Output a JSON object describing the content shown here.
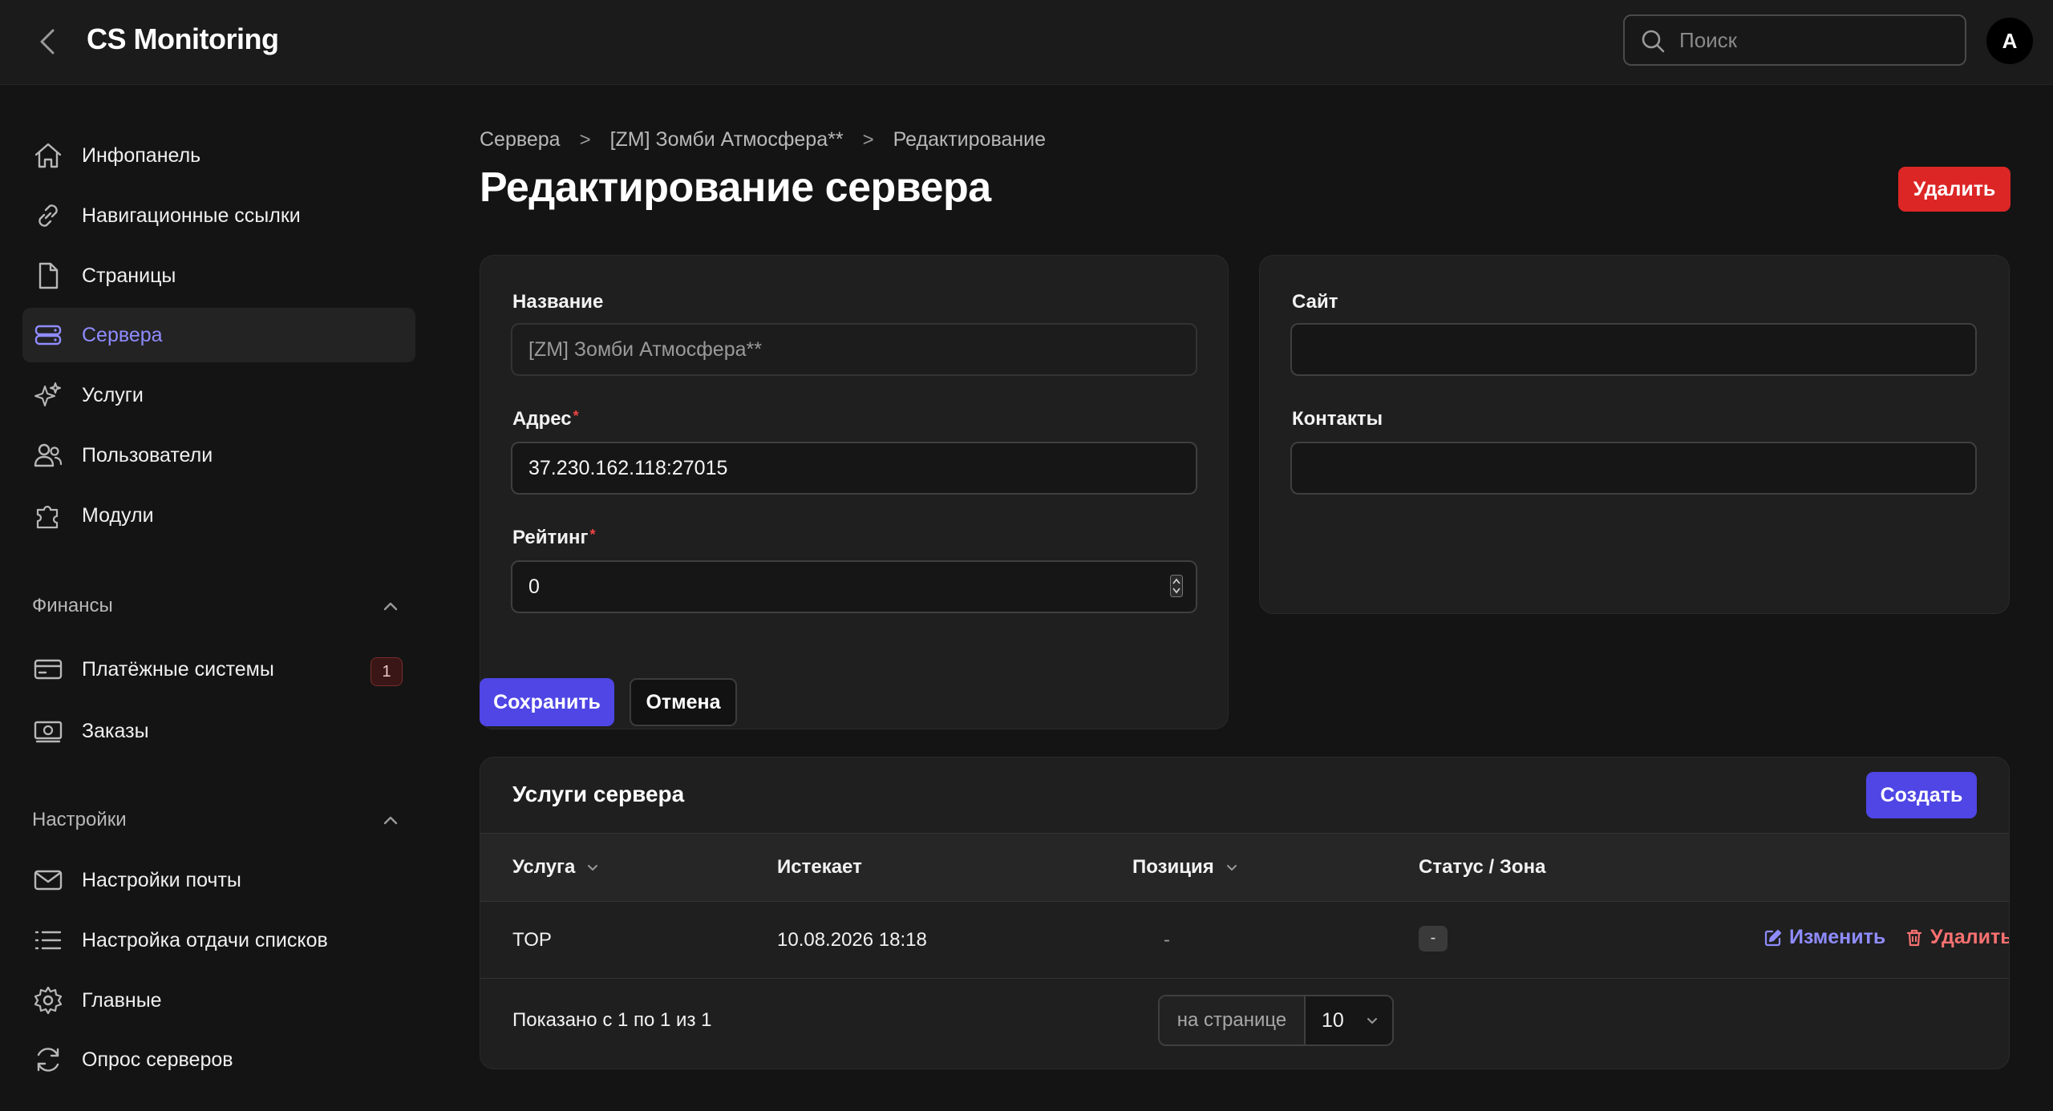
{
  "app": {
    "title": "CS Monitoring"
  },
  "search": {
    "placeholder": "Поиск"
  },
  "user": {
    "avatar_letter": "A"
  },
  "sidebar": {
    "items": [
      {
        "label": "Инфопанель",
        "icon": "home-icon"
      },
      {
        "label": "Навигационные ссылки",
        "icon": "link-icon"
      },
      {
        "label": "Страницы",
        "icon": "document-icon"
      },
      {
        "label": "Сервера",
        "icon": "server-icon",
        "active": true
      },
      {
        "label": "Услуги",
        "icon": "sparkles-icon"
      },
      {
        "label": "Пользователи",
        "icon": "users-icon"
      },
      {
        "label": "Модули",
        "icon": "puzzle-icon"
      }
    ],
    "finance": {
      "title": "Финансы",
      "items": [
        {
          "label": "Платёжные системы",
          "icon": "credit-card-icon",
          "badge": "1"
        },
        {
          "label": "Заказы",
          "icon": "banknotes-icon"
        }
      ]
    },
    "settings": {
      "title": "Настройки",
      "items": [
        {
          "label": "Настройки почты",
          "icon": "envelope-icon"
        },
        {
          "label": "Настройка отдачи списков",
          "icon": "list-icon"
        },
        {
          "label": "Главные",
          "icon": "gear-icon"
        },
        {
          "label": "Опрос серверов",
          "icon": "refresh-icon"
        }
      ]
    }
  },
  "breadcrumb": [
    "Сервера",
    "[ZM] Зомби Атмосфера**",
    "Редактирование"
  ],
  "page": {
    "title": "Редактирование сервера",
    "delete_label": "Удалить"
  },
  "form": {
    "name": {
      "label": "Название",
      "value": "[ZM] Зомби Атмосфера**"
    },
    "address": {
      "label": "Адрес",
      "value": "37.230.162.118:27015",
      "required_mark": "*"
    },
    "rating": {
      "label": "Рейтинг",
      "value": "0",
      "required_mark": "*"
    },
    "site": {
      "label": "Сайт",
      "value": ""
    },
    "contacts": {
      "label": "Контакты",
      "value": ""
    },
    "save_label": "Сохранить",
    "cancel_label": "Отмена"
  },
  "services": {
    "title": "Услуги сервера",
    "create_label": "Создать",
    "columns": [
      "Услуга",
      "Истекает",
      "Позиция",
      "Статус / Зона"
    ],
    "rows": [
      {
        "service": "TOP",
        "expires": "10.08.2026 18:18",
        "position": "-",
        "status": "-"
      }
    ],
    "edit_label": "Изменить",
    "delete_label": "Удалить",
    "footer_text": "Показано с 1 по 1 из 1",
    "per_page_label": "на странице",
    "per_page_value": "10"
  },
  "colors": {
    "accent": "#4f46e5",
    "danger": "#dc2626",
    "background": "#141414"
  }
}
